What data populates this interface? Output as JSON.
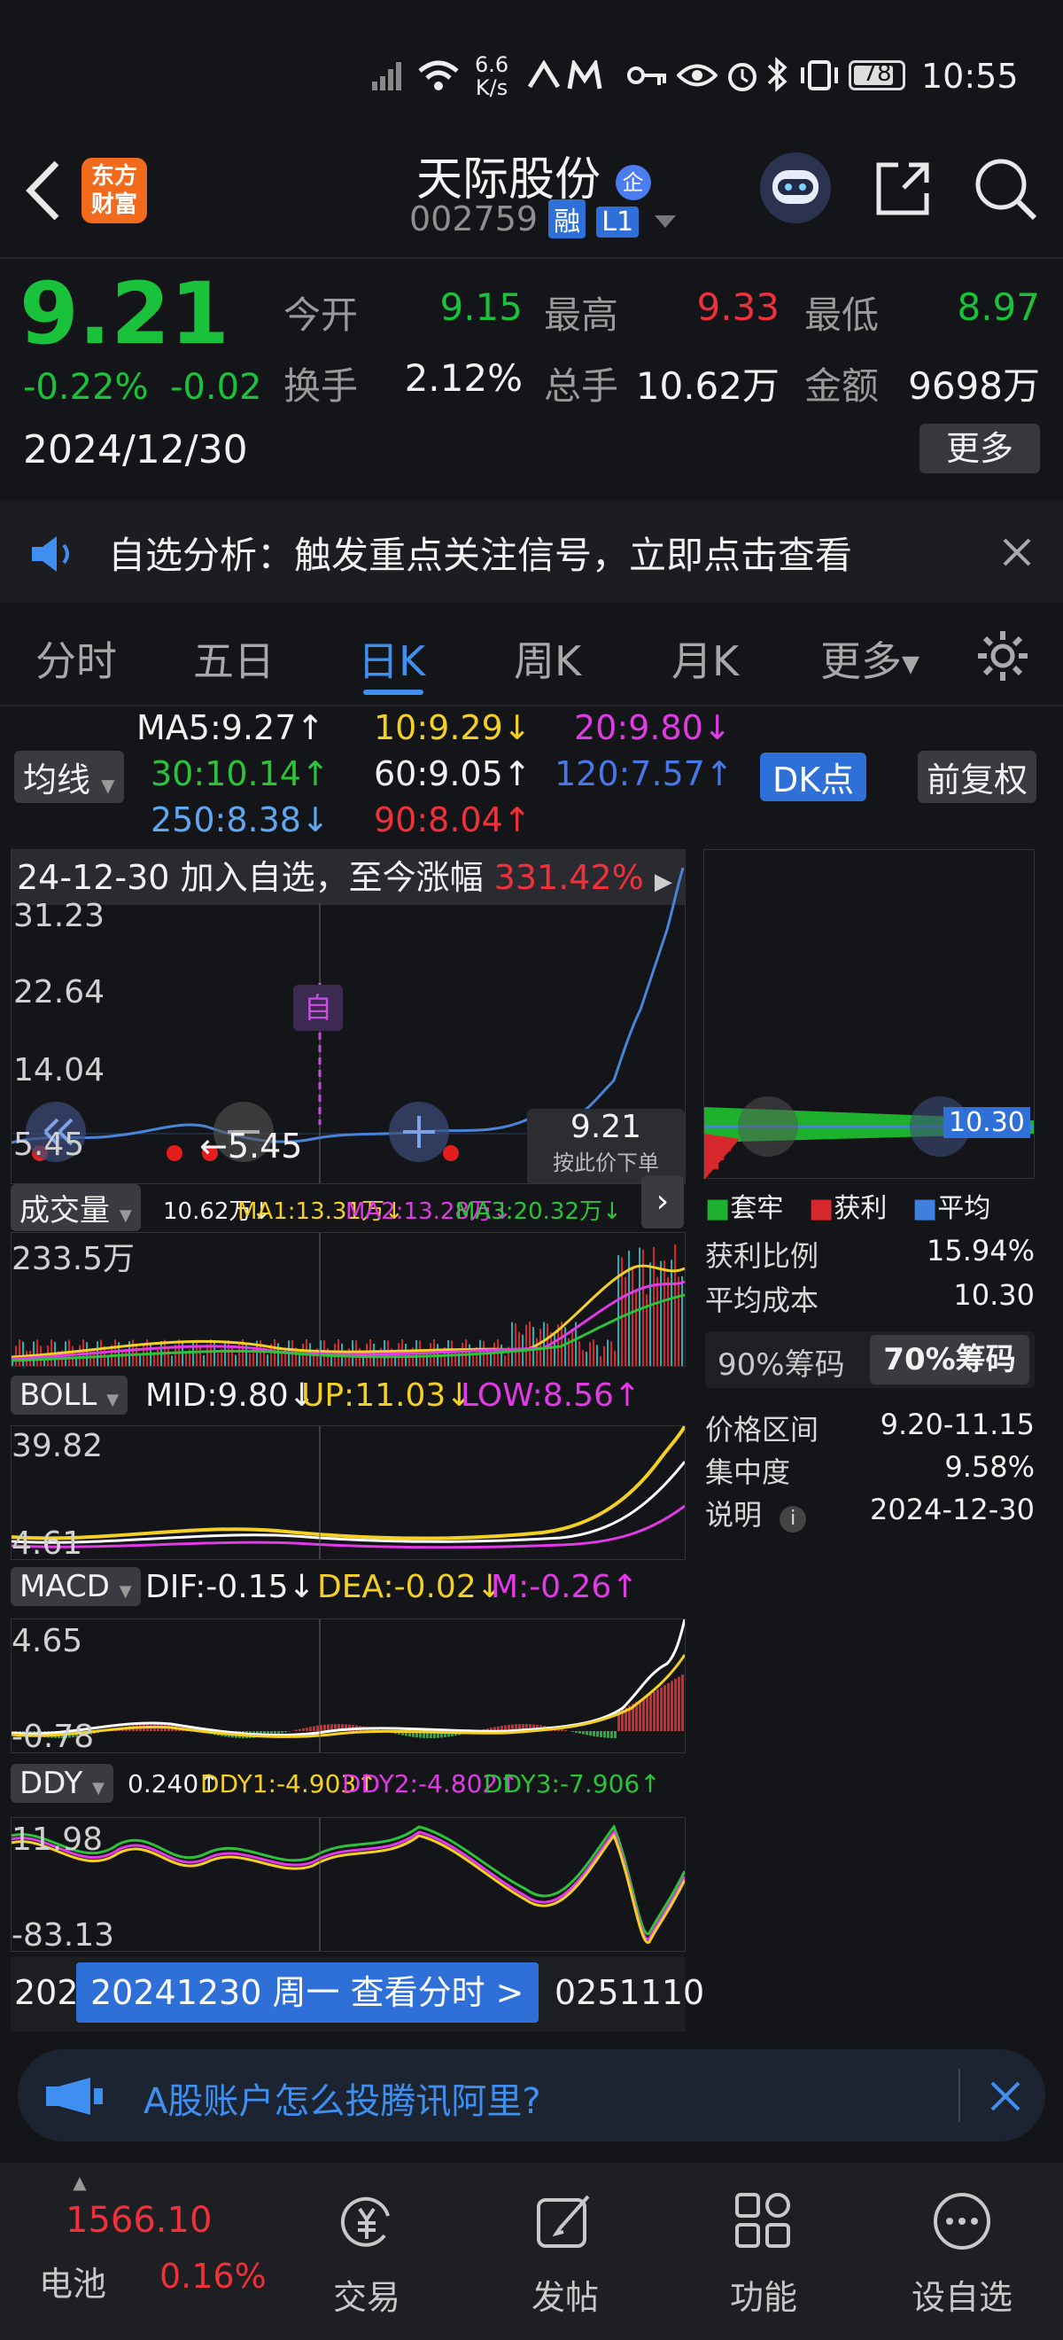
{
  "status_bar": {
    "net_speed_top": "6.6",
    "net_speed_bottom": "K/s",
    "battery": "78",
    "time": "10:55"
  },
  "header": {
    "logo_text_line1": "东方",
    "logo_text_line2": "财富",
    "stock_name": "天际股份",
    "name_badge": "企",
    "stock_code": "002759",
    "tag_rong": "融",
    "tag_level": "L1"
  },
  "quote": {
    "price": "9.21",
    "change_pct": "-0.22%",
    "change_amt": "-0.02",
    "date": "2024/12/30",
    "labels": {
      "open": "今开",
      "high": "最高",
      "low": "最低",
      "turnover": "换手",
      "volume": "总手",
      "amount": "金额"
    },
    "open": "9.15",
    "high": "9.33",
    "low": "8.97",
    "turnover": "2.12%",
    "volume": "10.62万",
    "amount": "9698万",
    "more_btn": "更多"
  },
  "notice": {
    "text": "自选分析：触发重点关注信号，立即点击查看"
  },
  "tabs": [
    "分时",
    "五日",
    "日K",
    "周K",
    "月K",
    "更多"
  ],
  "active_tab": "日K",
  "ma_legend": {
    "btn": "均线",
    "ma5": "MA5:9.27↑",
    "ma10": "10:9.29↓",
    "ma20": "20:9.80↓",
    "ma30": "30:10.14↑",
    "ma60": "60:9.05↑",
    "ma120": "120:7.57↑",
    "ma250": "250:8.38↓",
    "ma90": "90:8.04↑",
    "dk_btn": "DK点",
    "adjust_btn": "前复权"
  },
  "kline": {
    "banner_prefix": "24-12-30 加入自选，至今涨幅",
    "banner_pct": "331.42%",
    "y_labels": [
      "31.23",
      "22.64",
      "14.04",
      "5.45"
    ],
    "low_marker": "←5.45",
    "zi_marker": "自",
    "price_tag": "9.21",
    "price_hint": "按此价下单"
  },
  "volume": {
    "btn": "成交量",
    "val": "10.62万↓",
    "ma1": "MA1:13.31万↓",
    "ma2": "MA2:13.28万↓",
    "ma3": "MA3:20.32万↓",
    "y_label": "233.5万"
  },
  "boll": {
    "btn": "BOLL",
    "mid": "MID:9.80↓",
    "up": "UP:11.03↓",
    "low": "LOW:8.56↑",
    "y_top": "39.82",
    "y_bottom": "4.61"
  },
  "macd": {
    "btn": "MACD",
    "dif": "DIF:-0.15↓",
    "dea": "DEA:-0.02↓",
    "m": "M:-0.26↑",
    "y_top": "4.65",
    "y_bottom": "-0.78"
  },
  "ddy": {
    "btn": "DDY",
    "val": "0.240↑",
    "ddy1": "DDY1:-4.903↑",
    "ddy2": "DDY2:-4.802↑",
    "ddy3": "DDY3:-7.906↑",
    "y_top": "11.98",
    "y_bottom": "-83.13"
  },
  "timeline": {
    "left": "202",
    "right": "0251110",
    "tooltip": "20241230 周一 查看分时 >"
  },
  "chips": {
    "price_label": "10.30",
    "legend_trapped": "套牢",
    "legend_profit": "获利",
    "legend_avg": "平均",
    "rows": [
      {
        "label": "获利比例",
        "value": "15.94%"
      },
      {
        "label": "平均成本",
        "value": "10.30"
      }
    ],
    "toggle_90": "90%筹码",
    "toggle_70": "70%筹码",
    "rows2": [
      {
        "label": "价格区间",
        "value": "9.20-11.15"
      },
      {
        "label": "集中度",
        "value": "9.58%"
      },
      {
        "label": "说明",
        "value": "2024-12-30"
      }
    ]
  },
  "ad": {
    "text": "A股账户怎么投腾讯阿里?"
  },
  "bottom_nav": {
    "index_value": "1566.10",
    "index_name": "电池",
    "index_pct": "0.16%",
    "items": [
      "交易",
      "发帖",
      "功能",
      "设自选"
    ]
  },
  "colors": {
    "up": "#f0303a",
    "down": "#19c23a",
    "accent": "#3f8ff0",
    "ma_yellow": "#f4d024",
    "ma_magenta": "#e23ae6",
    "ma_green": "#2cc23a",
    "ma_blue": "#5fa8f0"
  }
}
